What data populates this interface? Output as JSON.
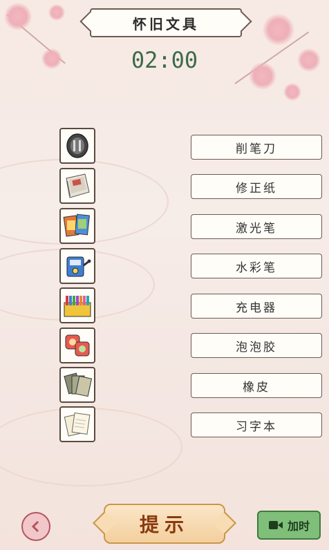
{
  "header": {
    "title": "怀旧文具"
  },
  "timer": {
    "value": "02:00"
  },
  "items": [
    {
      "icon": "pencil-sharpener-icon"
    },
    {
      "icon": "notebook-icon"
    },
    {
      "icon": "picture-cards-icon"
    },
    {
      "icon": "sharpener-machine-icon"
    },
    {
      "icon": "crayon-box-icon"
    },
    {
      "icon": "erasers-icon"
    },
    {
      "icon": "card-stack-icon"
    },
    {
      "icon": "paper-sheets-icon"
    }
  ],
  "labels": [
    "削笔刀",
    "修正纸",
    "激光笔",
    "水彩笔",
    "充电器",
    "泡泡胶",
    "橡皮",
    "习字本"
  ],
  "buttons": {
    "hint": "提示",
    "add_time": "加时"
  }
}
